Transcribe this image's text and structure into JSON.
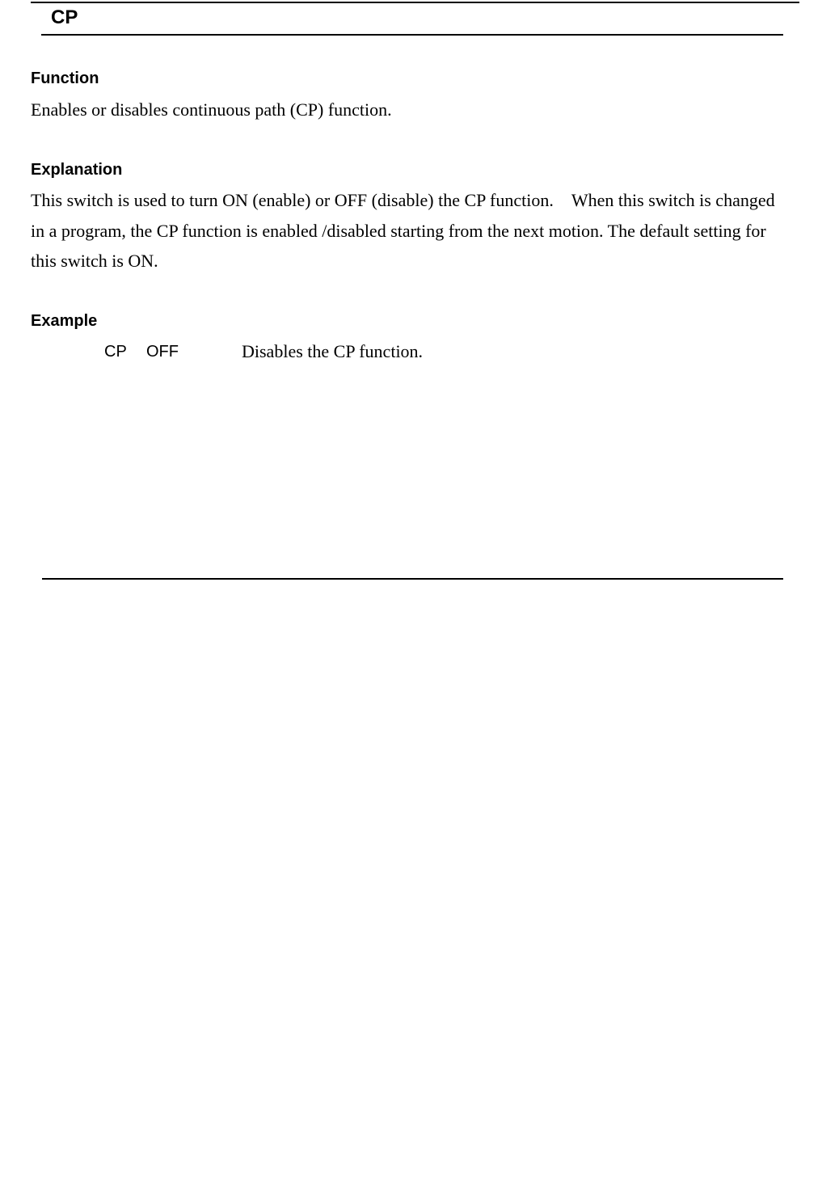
{
  "title": "CP",
  "sections": {
    "function": {
      "heading": "Function",
      "text": "Enables or disables continuous path (CP) function."
    },
    "explanation": {
      "heading": "Explanation",
      "text": "This switch is used to turn ON (enable) or OFF (disable) the CP function.    When this switch is changed in a program, the CP function is enabled /disabled starting from the next motion. The default setting for this switch is ON."
    },
    "example": {
      "heading": "Example",
      "command": "CP",
      "argument": "OFF",
      "description": "Disables the CP function."
    }
  }
}
